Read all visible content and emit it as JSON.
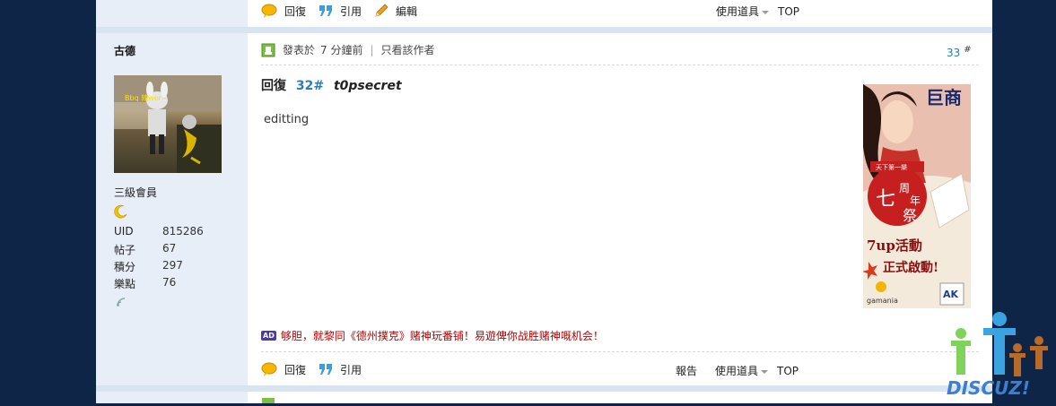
{
  "top_bar": {
    "reply": "回復",
    "quote": "引用",
    "edit": "編輯",
    "tools": "使用道具",
    "top": "TOP"
  },
  "post": {
    "author": "古德",
    "rank": "三級會員",
    "stats": [
      {
        "label": "UID",
        "value": "815286"
      },
      {
        "label": "帖子",
        "value": "67"
      },
      {
        "label": "積分",
        "value": "297"
      },
      {
        "label": "樂點",
        "value": "76"
      }
    ],
    "posted_prefix": "發表於",
    "posted_time": "7 分鐘前",
    "only_author": "只看該作者",
    "floor": "33",
    "floor_mark": "#",
    "title_prefix": "回復",
    "title_floor": "32#",
    "title_user": "t0psecret",
    "content": "editting",
    "ad_tag": "AD",
    "ad_text": "够胆，就黎同《德州撲克》赌神玩番铺！易遊俾你战胜赌神嘅机会！",
    "ad_banner": {
      "title": "巨商",
      "seal": [
        "天下第一樂",
        "七",
        "周",
        "年",
        "祭"
      ],
      "line1": "7up活動",
      "line2": "正式啟動!",
      "brand1": "gamania",
      "brand2": "AK"
    },
    "avatar_caption": "Bbq 辣wer~"
  },
  "bottom_bar": {
    "reply": "回復",
    "quote": "引用",
    "report": "報告",
    "tools": "使用道具",
    "top": "TOP"
  },
  "watermark": "DISCUZ!",
  "colors": {
    "background": "#0f2547",
    "side": "#e8eef7",
    "accent": "#2a7fb0"
  }
}
